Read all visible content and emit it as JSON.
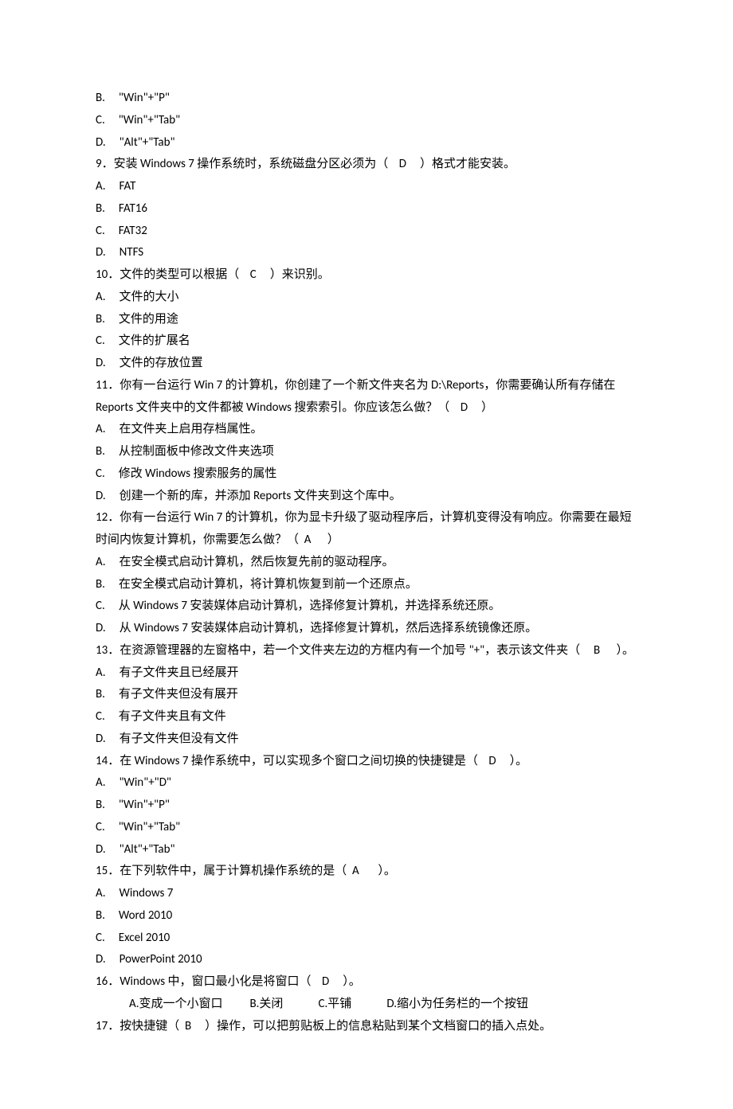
{
  "lines": [
    {
      "cls": "opt",
      "text": "B.     \"Win\"+\"P\""
    },
    {
      "cls": "opt",
      "text": "C.     \"Win\"+\"Tab\""
    },
    {
      "cls": "opt",
      "text": "D.     \"Alt\"+\"Tab\""
    },
    {
      "cls": "q",
      "text": "9．安装 Windows 7 操作系统时，系统磁盘分区必须为（    D     ）格式才能安装。"
    },
    {
      "cls": "opt",
      "text": "A.     FAT"
    },
    {
      "cls": "opt",
      "text": "B.     FAT16"
    },
    {
      "cls": "opt",
      "text": "C.     FAT32"
    },
    {
      "cls": "opt",
      "text": "D.     NTFS"
    },
    {
      "cls": "q",
      "text": "10．文件的类型可以根据（    C     ）来识别。"
    },
    {
      "cls": "opt",
      "text": "A.     文件的大小"
    },
    {
      "cls": "opt",
      "text": "B.     文件的用途"
    },
    {
      "cls": "opt",
      "text": "C.     文件的扩展名"
    },
    {
      "cls": "opt",
      "text": "D.     文件的存放位置"
    },
    {
      "cls": "q",
      "text": "11．你有一台运行 Win 7 的计算机，你创建了一个新文件夹名为 D:\\Reports，你需要确认所有存储在 Reports 文件夹中的文件都被 Windows 搜索索引。你应该怎么做？（    D     ）"
    },
    {
      "cls": "opt",
      "text": "A.     在文件夹上启用存档属性。"
    },
    {
      "cls": "opt",
      "text": "B.     从控制面板中修改文件夹选项"
    },
    {
      "cls": "opt",
      "text": "C.     修改 Windows 搜索服务的属性"
    },
    {
      "cls": "opt",
      "text": "D.     创建一个新的库，并添加 Reports 文件夹到这个库中。"
    },
    {
      "cls": "q",
      "text": "12．你有一台运行 Win 7 的计算机，你为显卡升级了驱动程序后，计算机变得没有响应。你需要在最短时间内恢复计算机，你需要怎么做？（  A      ）"
    },
    {
      "cls": "opt",
      "text": "A.     在安全模式启动计算机，然后恢复先前的驱动程序。"
    },
    {
      "cls": "opt",
      "text": "B.     在安全模式启动计算机，将计算机恢复到前一个还原点。"
    },
    {
      "cls": "opt",
      "text": "C.     从 Windows 7 安装媒体启动计算机，选择修复计算机，并选择系统还原。"
    },
    {
      "cls": "opt",
      "text": "D.     从 Windows 7 安装媒体启动计算机，选择修复计算机，然后选择系统镜像还原。"
    },
    {
      "cls": "q",
      "text": "13．在资源管理器的左窗格中，若一个文件夹左边的方框内有一个加号 \"+\"，表示该文件夹（     B      ）。"
    },
    {
      "cls": "opt",
      "text": "A.     有子文件夹且已经展开"
    },
    {
      "cls": "opt",
      "text": "B.     有子文件夹但没有展开"
    },
    {
      "cls": "opt",
      "text": "C.     有子文件夹且有文件"
    },
    {
      "cls": "opt",
      "text": "D.     有子文件夹但没有文件"
    },
    {
      "cls": "q",
      "text": "14．在 Windows 7 操作系统中，可以实现多个窗口之间切换的快捷键是（    D     ）。"
    },
    {
      "cls": "opt",
      "text": "A.     \"Win\"+\"D\""
    },
    {
      "cls": "opt",
      "text": "B.     \"Win\"+\"P\""
    },
    {
      "cls": "opt",
      "text": "C.     \"Win\"+\"Tab\""
    },
    {
      "cls": "opt",
      "text": "D.     \"Alt\"+\"Tab\""
    },
    {
      "cls": "q",
      "text": "15．在下列软件中，属于计算机操作系统的是（  A       ）。"
    },
    {
      "cls": "opt",
      "text": "A.     Windows 7"
    },
    {
      "cls": "opt",
      "text": "B.     Word 2010"
    },
    {
      "cls": "opt",
      "text": "C.     Excel 2010"
    },
    {
      "cls": "opt",
      "text": "D.     PowerPoint 2010"
    },
    {
      "cls": "q",
      "text": "16．Windows 中，窗口最小化是将窗口（    D     ）。"
    },
    {
      "cls": "inline",
      "text": "A.变成一个小窗口          B.关闭             C.平铺             D.缩小为任务栏的一个按钮"
    },
    {
      "cls": "q",
      "text": "17．按快捷键（  B     ）操作，可以把剪贴板上的信息粘贴到某个文档窗口的插入点处。"
    }
  ]
}
